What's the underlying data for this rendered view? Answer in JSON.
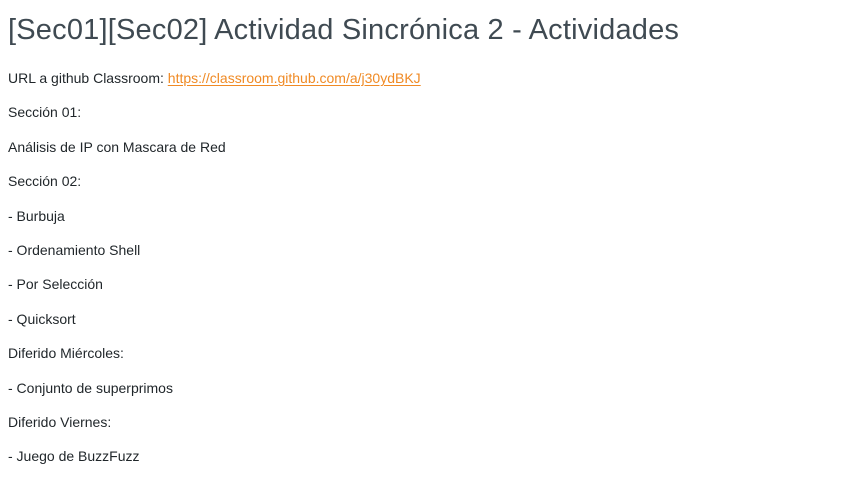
{
  "page": {
    "title": "[Sec01][Sec02] Actividad Sincrónica 2 - Actividades"
  },
  "content": {
    "classroom_prefix": "URL a github Classroom: ",
    "classroom_link_text": "https://classroom.github.com/a/j30ydBKJ",
    "lines": [
      "Sección 01:",
      "Análisis de IP con Mascara de Red",
      "Sección 02:",
      "- Burbuja",
      "- Ordenamiento Shell",
      "- Por Selección",
      "- Quicksort",
      "Diferido Miércoles:",
      "- Conjunto de superprimos",
      "Diferido Viernes:",
      "- Juego de BuzzFuzz"
    ]
  },
  "colors": {
    "title": "#3f4a52",
    "text": "#1f2529",
    "link": "#f08a24",
    "background": "#ffffff"
  }
}
